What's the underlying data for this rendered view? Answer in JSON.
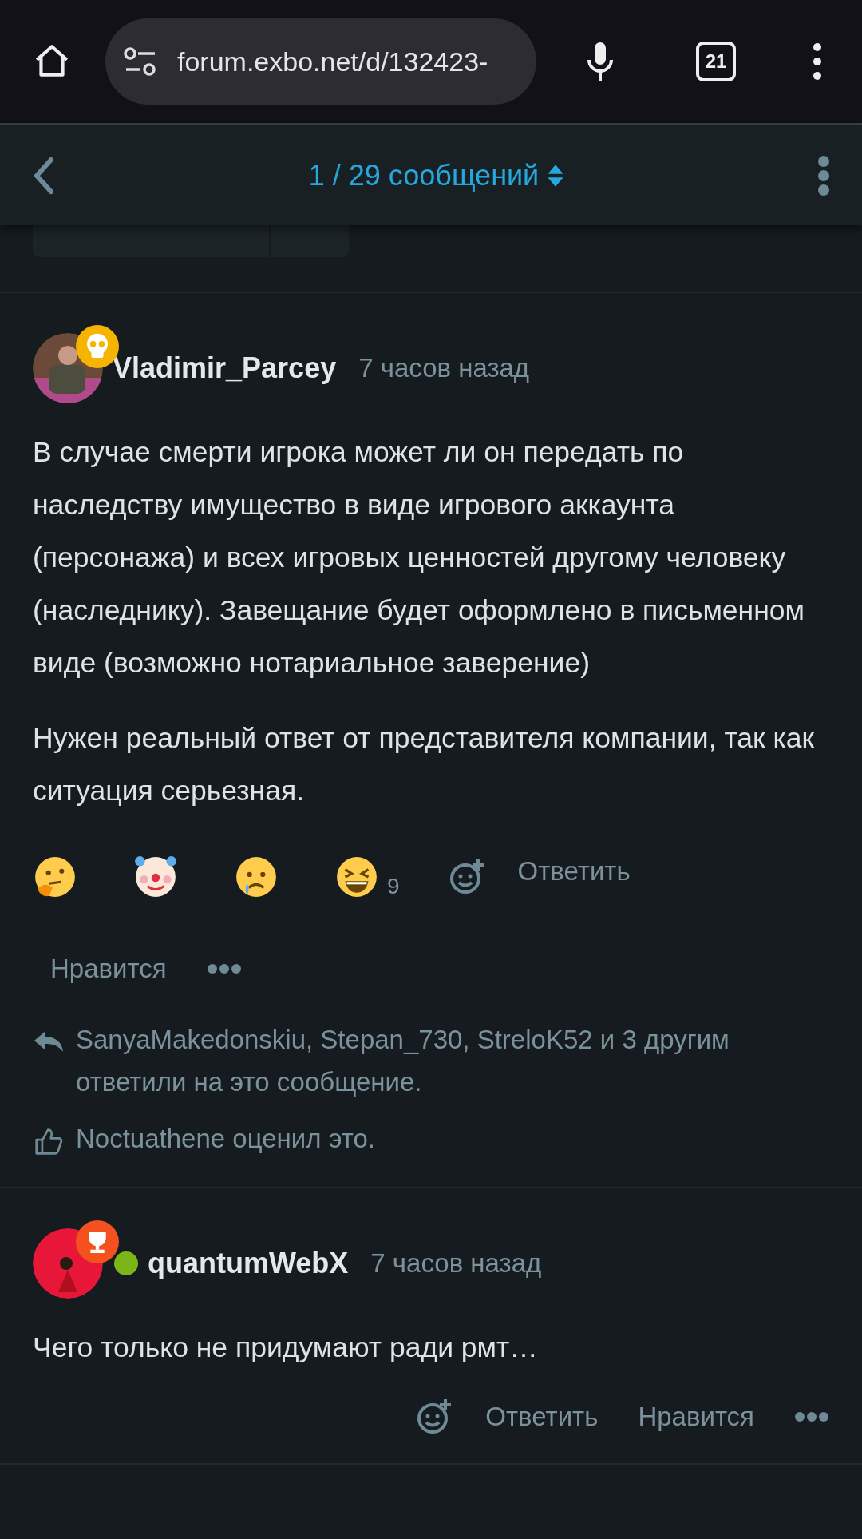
{
  "browser": {
    "url": "forum.exbo.net/d/132423-",
    "tab_count": "21"
  },
  "discussion_header": {
    "position": "1 / 29 сообщений"
  },
  "posts": [
    {
      "author": "Vladimir_Parcey",
      "time": "7 часов назад",
      "badge": {
        "kind": "skull"
      },
      "online": false,
      "paragraphs": [
        "В случае смерти игрока может ли он передать по наследству имущество в виде игрового аккаунта (персонажа) и всех игровых ценностей другому человеку (наследнику). Завещание будет оформлено в письменном виде (возможно нотариальное заверение)",
        "Нужен реальный ответ от представителя компании, так как ситуация серьезная."
      ],
      "reactions": [
        {
          "kind": "thinking"
        },
        {
          "kind": "clown"
        },
        {
          "kind": "crying"
        },
        {
          "kind": "laughing",
          "count": "9"
        }
      ],
      "actions": [
        "Ответить",
        "Нравится"
      ],
      "replies": "SanyaMakedonskiu, Stepan_730, StreloK52 и 3 другим ответили на это сообщение.",
      "likes": "Noctuathene оценил это."
    },
    {
      "author": "quantumWebX",
      "time": "7 часов назад",
      "badge": {
        "kind": "trophy"
      },
      "online": true,
      "paragraphs": [
        "Чего только не придумают ради рмт…"
      ],
      "actions": [
        "Ответить",
        "Нравится"
      ]
    }
  ]
}
